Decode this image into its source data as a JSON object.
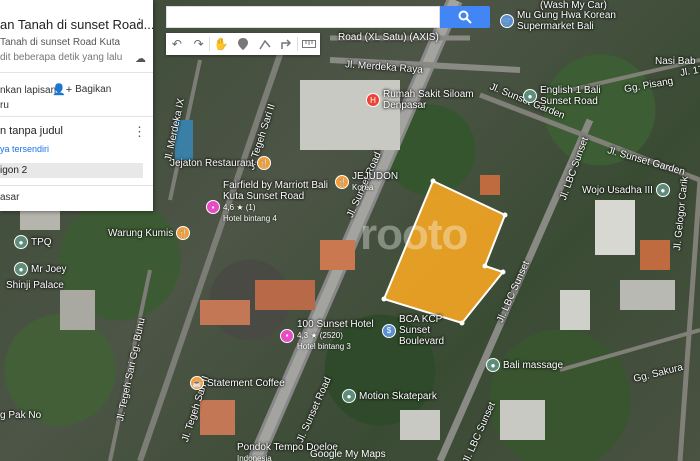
{
  "panel": {
    "title": "an Tanah di sunset Road...",
    "subtitle": "Tanah di sunset Road Kuta",
    "status": "dit beberapa detik yang lalu",
    "add_layer_label": "nkan lapisan",
    "add_layer_label2": "ru",
    "share_label": "Bagikan",
    "layer_title": "n tanpa judul",
    "style_link": "ya tersendiri",
    "item": "igon 2",
    "base_map": "asar"
  },
  "search": {
    "value": "",
    "placeholder": ""
  },
  "toolbar": {
    "tools": [
      "undo-icon",
      "redo-icon",
      "hand-icon",
      "marker-icon",
      "line-icon",
      "route-icon",
      "ruler-icon"
    ]
  },
  "roads": {
    "merdeka_raya": "Jl. Merdeka Raya",
    "sunset_road": "Jl. Sunset Road",
    "sunset_road_2": "Jl. Sunset Road",
    "tegeh_sari_1": "Jl. Tegeh Sari II",
    "tegeh_sari_2": "Jl. Tegeh Sari II",
    "lbc_sunset": "Jl. LBC Sunset",
    "lbc_sunset_2": "Jl. LBC Sunset",
    "lbc_sunset_3": "Jl. LBC Sunset",
    "sunset_garden": "Jl. Sunset Garden",
    "sunset_garden_2": "Jl. Sunset Garden",
    "merdeka_9": "Jl. Merdeka IX",
    "xl_satu": "Road (XL Satu) (AXIS)",
    "gelogor_carik": "Jl. Gelogor Carik",
    "gg_sakura": "Gg. Sakura",
    "gg_pisang": "Gg. Pisang",
    "pisang_17": "Jl. 17",
    "sari_bunu": "Jl. Tegeh Sari Gg. Bunu",
    "pak_no": "g Pak No"
  },
  "pois": {
    "rs_siloam": "Rumah Sakit Siloam Denpasar",
    "jejaton": "Jejaton Restaurant",
    "jejudon": "JEJUDON",
    "jejudon_sub": "Korea",
    "fairfield": "Fairfield by Marriott Bali Kuta Sunset Road",
    "fairfield_sub": "Hotel bintang 4",
    "fairfield_rating": "4,6 ★ (1)",
    "warung_kumis": "Warung Kumis",
    "tpq": "TPQ",
    "mr_joey": "Mr Joey",
    "shinji": "Shinji Palace",
    "sunset_hotel": "100 Sunset Hotel",
    "sunset_hotel_sub": "Hotel bintang 3",
    "sunset_hotel_rating": "4,3 ★ (2520)",
    "bca": "BCA KCP Sunset Boulevard",
    "statement": "Statement Coffee",
    "motion": "Motion Skatepark",
    "pondok_tempo": "Pondok Tempo Doeloe",
    "pondok_tempo_sub": "Indonesia",
    "english1": "English 1 Bali Sunset Road",
    "mugung": "Mu Gung Hwa Korean Supermarket Bali",
    "wash": "(Wash My Car)",
    "nasi_bab": "Nasi Bab",
    "wojo": "Wojo Usadha III",
    "bali_massage": "Bali massage"
  },
  "watermark": "rooto",
  "attribution": "Google My Maps",
  "colors": {
    "polygon_fill": "#f5a623",
    "polygon_stroke": "#ffffff",
    "search_button": "#4285f4",
    "poi_food": "#f29d38",
    "poi_hotel": "#e84cc5",
    "poi_health": "#ea4335",
    "poi_bank": "#5b8fd4",
    "poi_generic": "#5e8c7a"
  }
}
